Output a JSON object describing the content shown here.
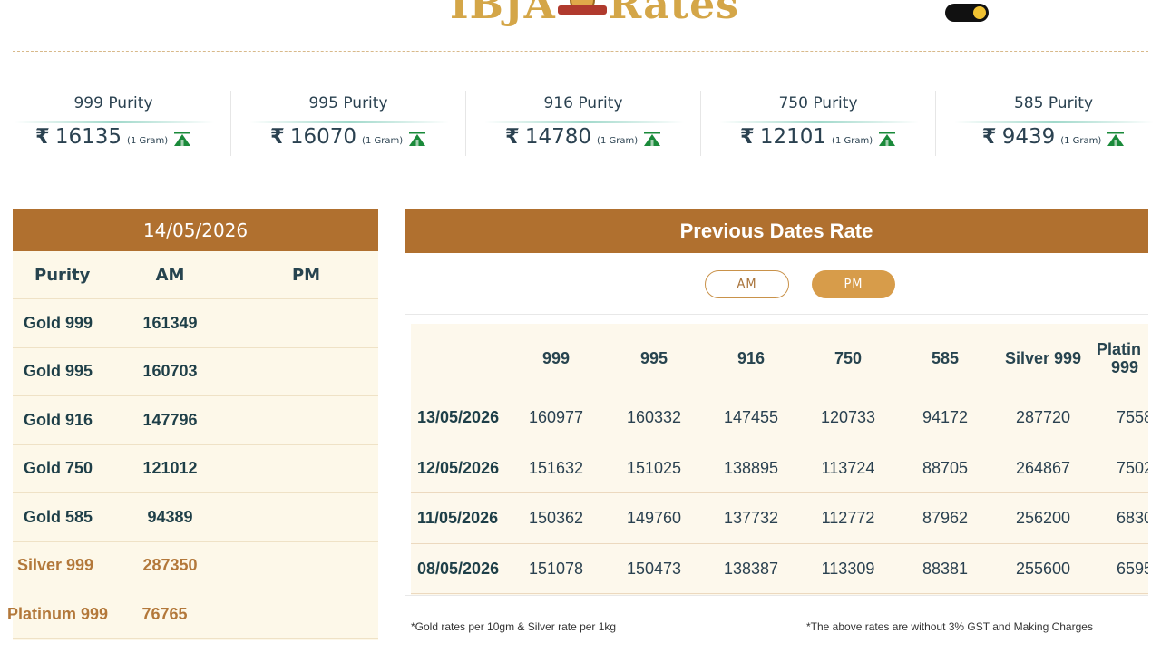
{
  "header": {
    "logo_left": "IBJA",
    "logo_right": "Rates"
  },
  "purity_ticker": [
    {
      "title": "999 Purity",
      "currency": "₹",
      "amount": "16135",
      "unit": "(1 Gram)",
      "trend": "up-arrow-icon"
    },
    {
      "title": "995 Purity",
      "currency": "₹",
      "amount": "16070",
      "unit": "(1 Gram)",
      "trend": "up-arrow-icon"
    },
    {
      "title": "916 Purity",
      "currency": "₹",
      "amount": "14780",
      "unit": "(1 Gram)",
      "trend": "up-arrow-icon"
    },
    {
      "title": "750 Purity",
      "currency": "₹",
      "amount": "12101",
      "unit": "(1 Gram)",
      "trend": "up-arrow-icon"
    },
    {
      "title": "585 Purity",
      "currency": "₹",
      "amount": "9439",
      "unit": "(1 Gram)",
      "trend": "up-arrow-icon"
    }
  ],
  "today": {
    "date": "14/05/2026",
    "columns": [
      "Purity",
      "AM",
      "PM"
    ],
    "rows": [
      {
        "purity": "Gold 999",
        "am": "161349",
        "pm": ""
      },
      {
        "purity": "Gold 995",
        "am": "160703",
        "pm": ""
      },
      {
        "purity": "Gold 916",
        "am": "147796",
        "pm": ""
      },
      {
        "purity": "Gold 750",
        "am": "121012",
        "pm": ""
      },
      {
        "purity": "Gold 585",
        "am": "94389",
        "pm": ""
      },
      {
        "purity": "Silver 999",
        "am": "287350",
        "pm": ""
      },
      {
        "purity": "Platinum 999",
        "am": "76765",
        "pm": ""
      }
    ]
  },
  "previous": {
    "title": "Previous Dates Rate",
    "toggle": {
      "am": "AM",
      "pm": "PM",
      "selected": "PM"
    },
    "columns": [
      "999",
      "995",
      "916",
      "750",
      "585",
      "Silver 999",
      "Platin",
      "999"
    ],
    "rows": [
      {
        "date": "13/05/2026",
        "values": [
          "160977",
          "160332",
          "147455",
          "120733",
          "94172",
          "287720",
          "7558"
        ]
      },
      {
        "date": "12/05/2026",
        "values": [
          "151632",
          "151025",
          "138895",
          "113724",
          "88705",
          "264867",
          "7502"
        ]
      },
      {
        "date": "11/05/2026",
        "values": [
          "150362",
          "149760",
          "137732",
          "112772",
          "87962",
          "256200",
          "6830"
        ]
      },
      {
        "date": "08/05/2026",
        "values": [
          "151078",
          "150473",
          "138387",
          "113309",
          "88381",
          "255600",
          "6595"
        ]
      }
    ]
  },
  "notes": {
    "left": "*Gold rates per 10gm & Silver rate per 1kg",
    "right": "*The above rates are without 3% GST and Making Charges"
  },
  "colors": {
    "brand_brown": "#b0702f",
    "cream": "#fdf8e9",
    "teal_text": "#1e3f48",
    "silver_text": "#b3783a",
    "trend_green": "#1a8a3a"
  }
}
